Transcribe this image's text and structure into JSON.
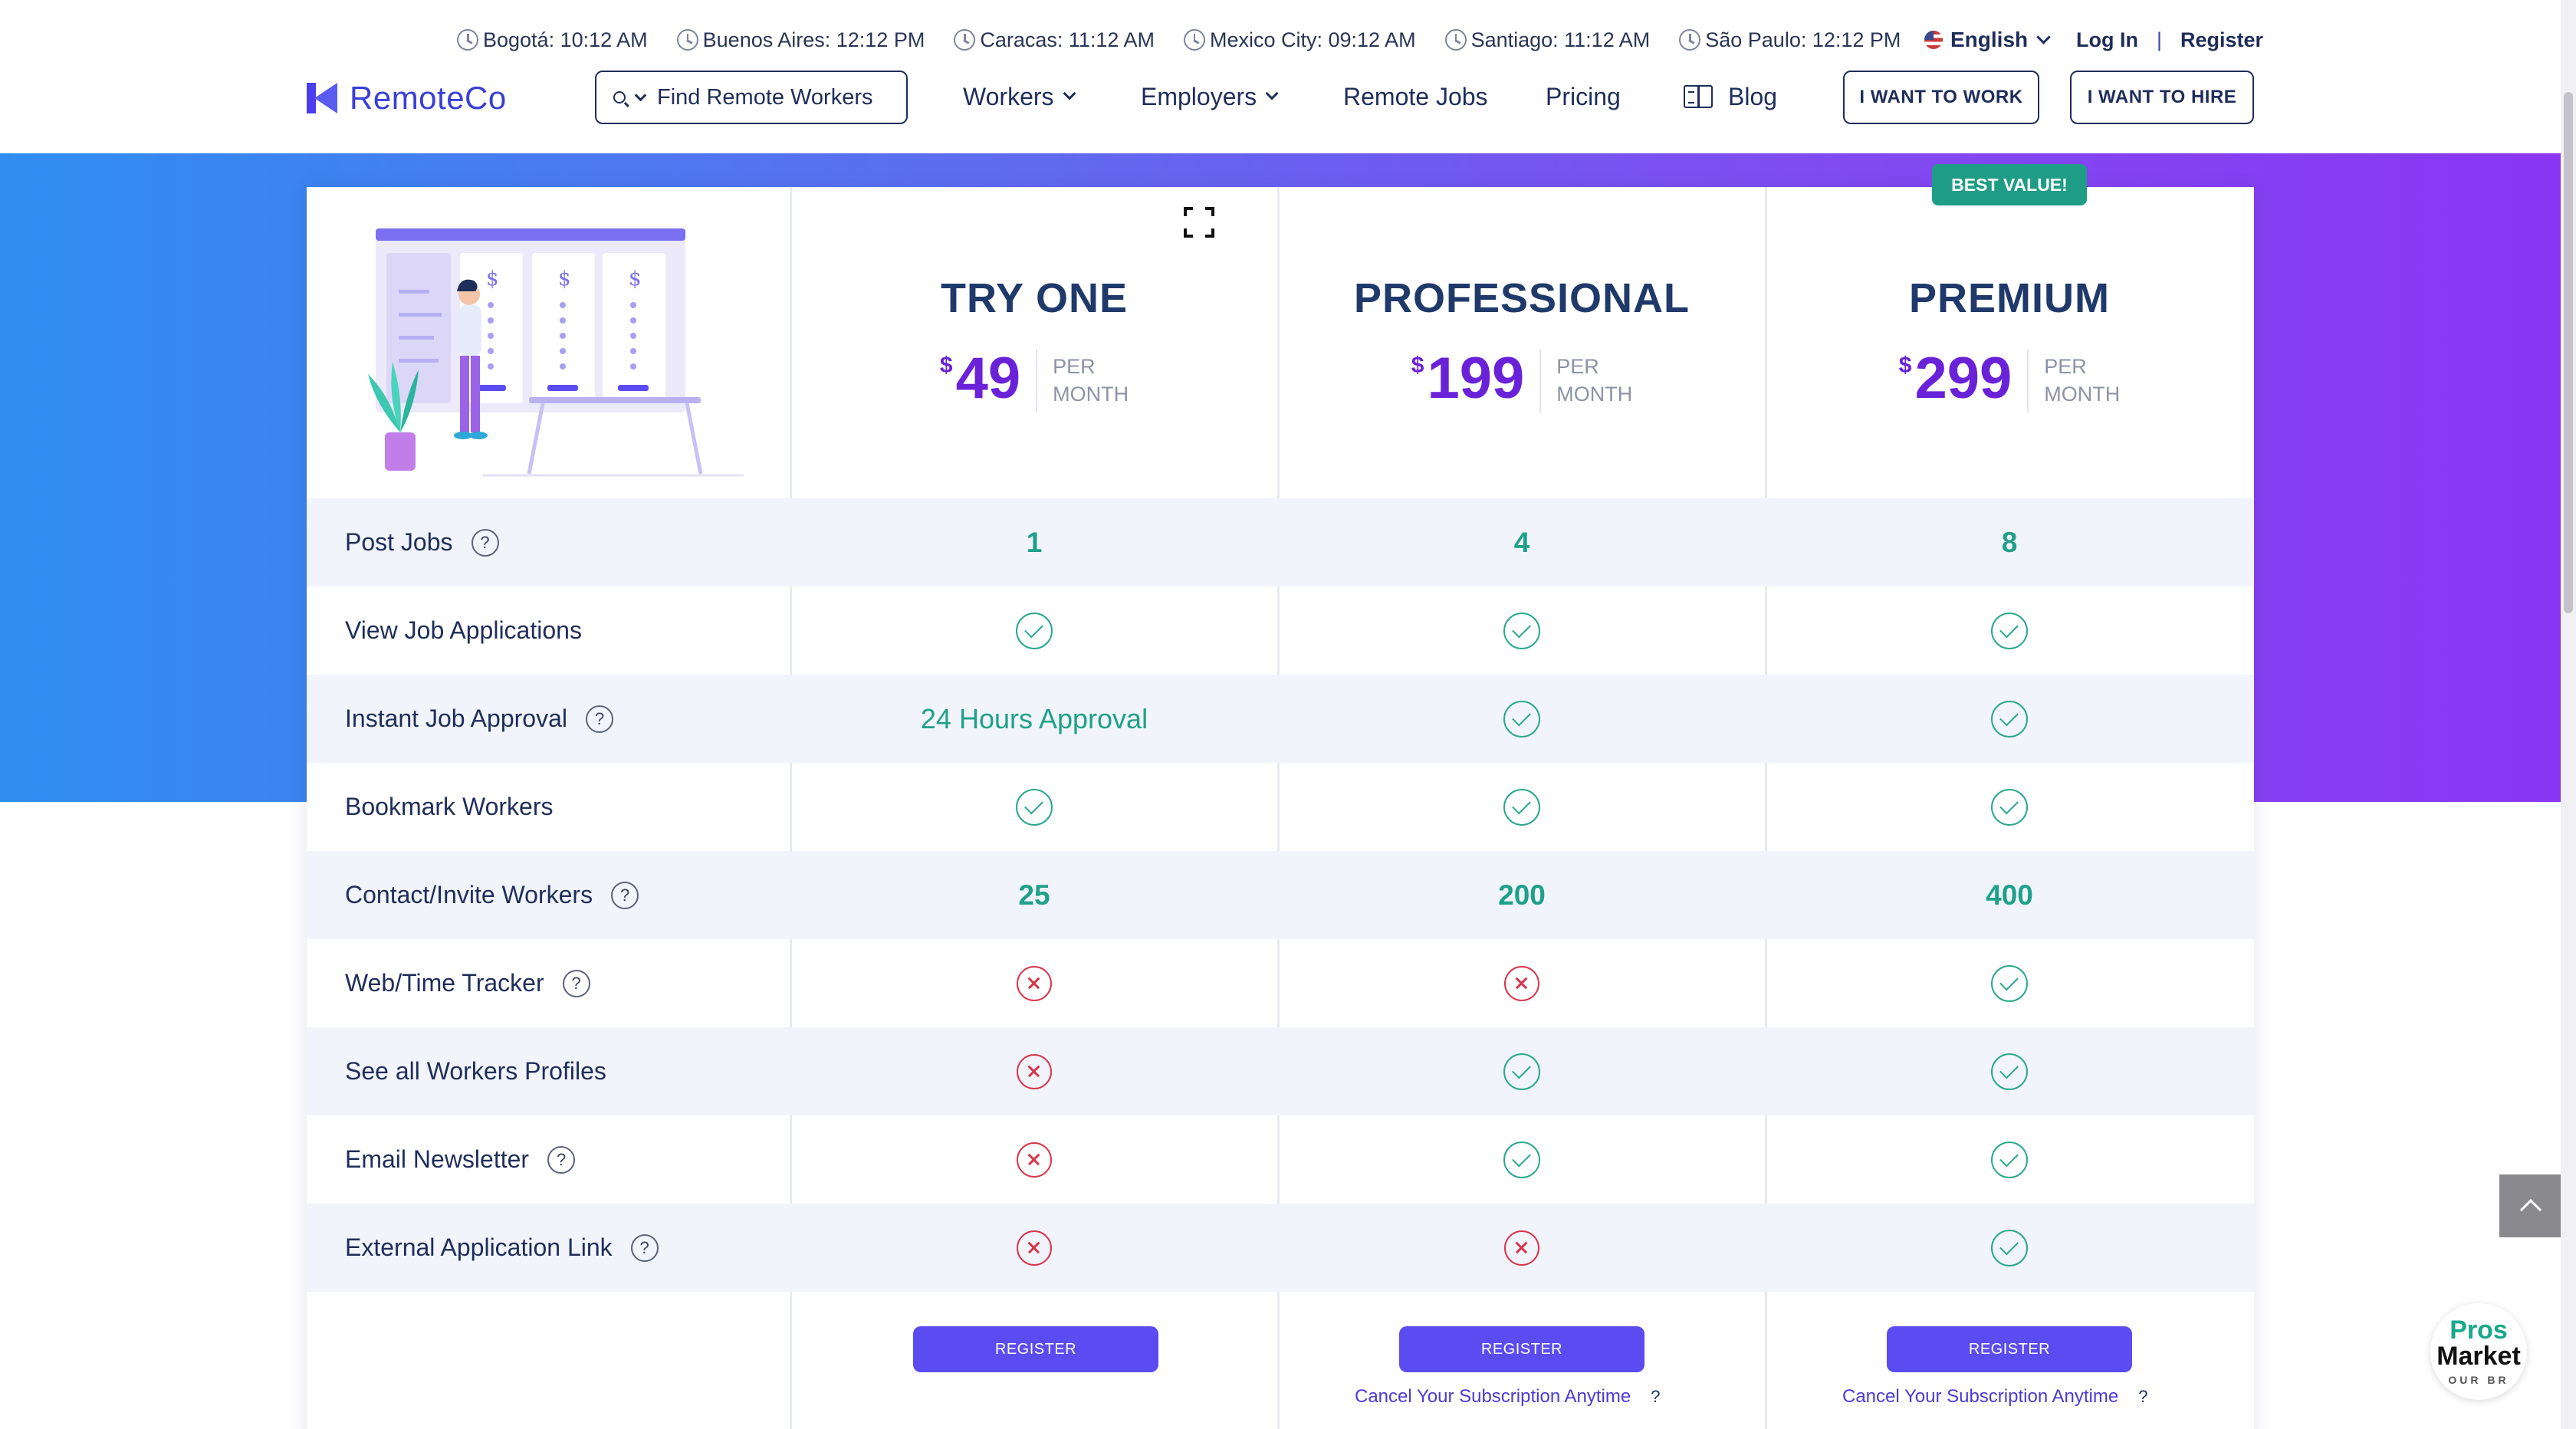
{
  "clocks": [
    {
      "label": "Bogotá: 10:12 AM"
    },
    {
      "label": "Buenos Aires: 12:12 PM"
    },
    {
      "label": "Caracas: 11:12 AM"
    },
    {
      "label": "Mexico City: 09:12 AM"
    },
    {
      "label": "Santiago: 11:12 AM"
    },
    {
      "label": "São Paulo: 12:12 PM"
    }
  ],
  "language": "English",
  "auth": {
    "login": "Log In",
    "separator": "|",
    "register": "Register"
  },
  "brand": {
    "name": "RemoteCo"
  },
  "search": {
    "placeholder": "Find Remote Workers"
  },
  "nav": {
    "workers": "Workers",
    "employers": "Employers",
    "remote_jobs": "Remote Jobs",
    "pricing": "Pricing",
    "blog": "Blog",
    "want_to_work": "I WANT TO WORK",
    "want_to_hire": "I WANT TO HIRE"
  },
  "badge": "BEST VALUE!",
  "plans": [
    {
      "name": "TRY ONE",
      "currency": "$",
      "price": "49",
      "per1": "PER",
      "per2": "MONTH",
      "register": "REGISTER"
    },
    {
      "name": "PROFESSIONAL",
      "currency": "$",
      "price": "199",
      "per1": "PER",
      "per2": "MONTH",
      "register": "REGISTER",
      "cancel": "Cancel Your Subscription Anytime",
      "q": "?"
    },
    {
      "name": "PREMIUM",
      "currency": "$",
      "price": "299",
      "per1": "PER",
      "per2": "MONTH",
      "register": "REGISTER",
      "cancel": "Cancel Your Subscription Anytime",
      "q": "?"
    }
  ],
  "features": [
    {
      "label": "Post Jobs",
      "help": "?",
      "values": [
        "1",
        "4",
        "8"
      ]
    },
    {
      "label": "View Job Applications",
      "values": [
        "check",
        "check",
        "check"
      ]
    },
    {
      "label": "Instant Job Approval",
      "help": "?",
      "values": [
        "24 Hours Approval",
        "check",
        "check"
      ]
    },
    {
      "label": "Bookmark Workers",
      "values": [
        "check",
        "check",
        "check"
      ]
    },
    {
      "label": "Contact/Invite Workers",
      "help": "?",
      "values": [
        "25",
        "200",
        "400"
      ]
    },
    {
      "label": "Web/Time Tracker",
      "help": "?",
      "values": [
        "cross",
        "cross",
        "check"
      ]
    },
    {
      "label": "See all Workers Profiles",
      "values": [
        "cross",
        "check",
        "check"
      ]
    },
    {
      "label": "Email Newsletter",
      "help": "?",
      "values": [
        "cross",
        "check",
        "check"
      ]
    },
    {
      "label": "External Application Link",
      "help": "?",
      "values": [
        "cross",
        "cross",
        "check"
      ]
    }
  ],
  "widget": {
    "line1": "Pros",
    "line2": "Market",
    "line3": "OUR BR"
  },
  "colors": {
    "accent": "#5a4cf0",
    "price": "#6a22d8",
    "check": "#2aa88e",
    "cross": "#d8344a",
    "badge": "#1f9c86"
  }
}
